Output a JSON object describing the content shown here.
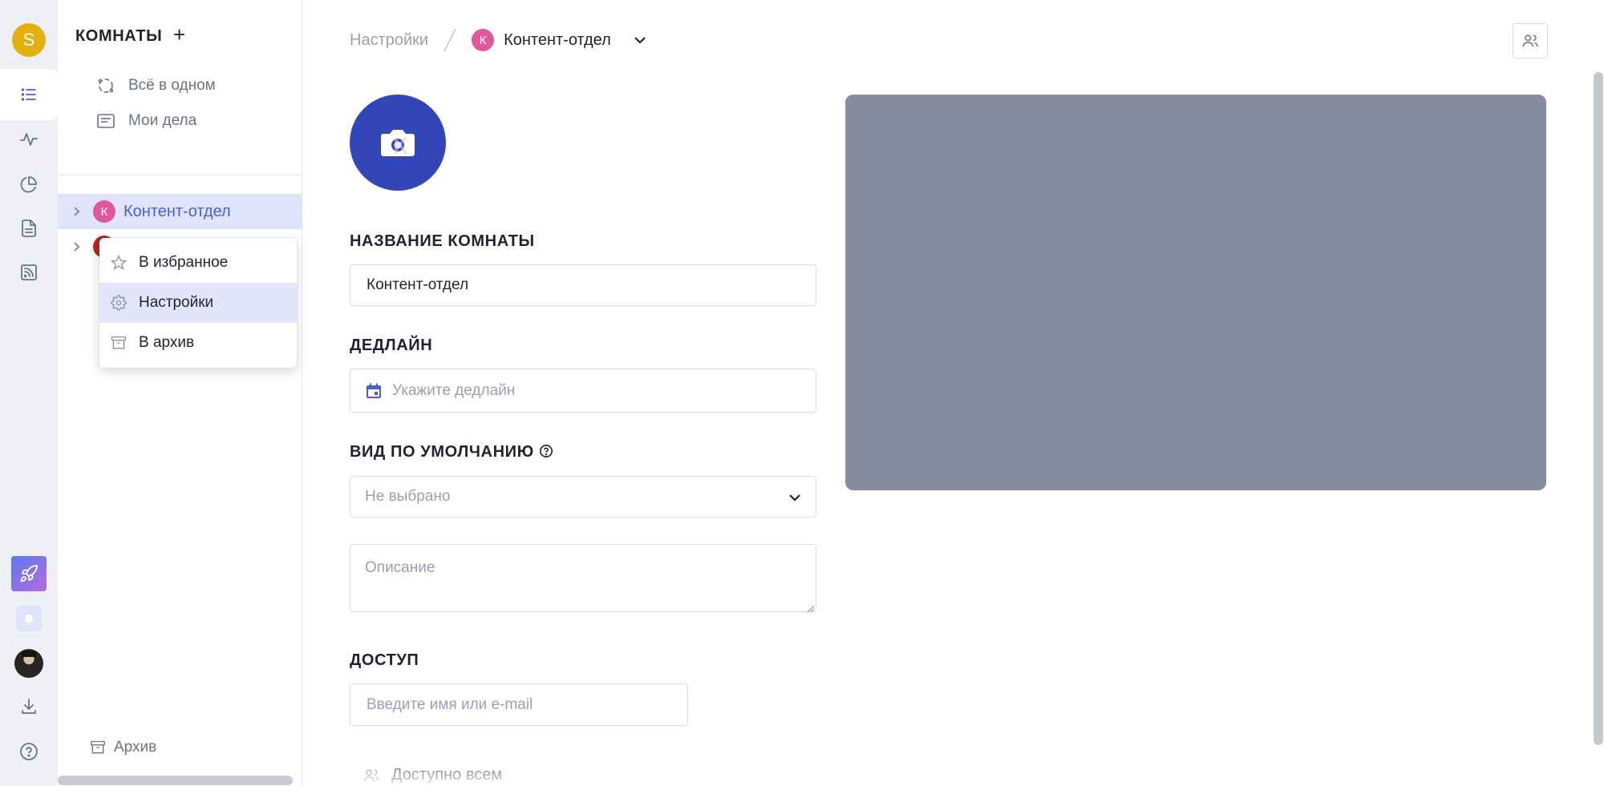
{
  "user": {
    "initial": "S",
    "avatar_color": "#e2b10d"
  },
  "rail": {
    "icons": [
      "list-icon",
      "activity-icon",
      "pie-chart-icon",
      "document-icon",
      "rss-icon"
    ],
    "bottom_icons": [
      "rocket-icon",
      "bell-icon",
      "user-photo",
      "download-icon",
      "help-icon"
    ]
  },
  "sidebar": {
    "title": "КОМНАТЫ",
    "add_symbol": "+",
    "nav": [
      {
        "label": "Всё в одном",
        "icon": "orbit-icon"
      },
      {
        "label": "Мои дела",
        "icon": "tasks-icon"
      }
    ],
    "rooms": [
      {
        "initial": "К",
        "label": "Контент-отдел",
        "color": "#e0579b",
        "selected": true
      },
      {
        "initial": "",
        "label": "",
        "color": "#b3261e",
        "selected": false
      }
    ],
    "archive_label": "Архив"
  },
  "context_menu": {
    "items": [
      {
        "label": "В избранное",
        "icon": "star-icon"
      },
      {
        "label": "Настройки",
        "icon": "gear-icon",
        "hover": true
      },
      {
        "label": "В архив",
        "icon": "archive-icon"
      }
    ]
  },
  "breadcrumb": {
    "root": "Настройки",
    "current_initial": "К",
    "current": "Контент-отдел"
  },
  "form": {
    "name_label": "НАЗВАНИЕ КОМНАТЫ",
    "name_value": "Контент-отдел",
    "deadline_label": "ДЕДЛАЙН",
    "deadline_placeholder": "Укажите дедлайн",
    "view_label": "ВИД ПО УМОЛЧАНИЮ",
    "view_value": "Не выбрано",
    "description_placeholder": "Описание",
    "access_label": "ДОСТУП",
    "access_placeholder": "Введите имя или e-mail",
    "access_everyone": "Доступно всем"
  },
  "colors": {
    "accent": "#4a5fd6",
    "room_avatar_bg": "#3346b8",
    "cover_bg": "#878c9e",
    "selected_row_bg": "#dfe4fa"
  }
}
